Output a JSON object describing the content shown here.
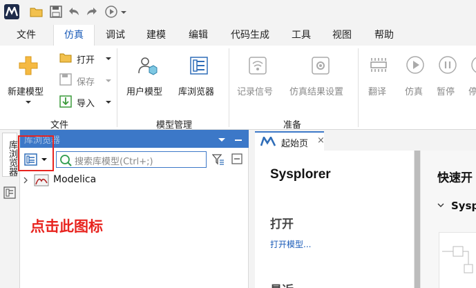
{
  "quick_access": {
    "icons": [
      "open-folder-icon",
      "save-icon",
      "undo-icon",
      "redo-icon",
      "run-icon",
      "dropdown-icon"
    ]
  },
  "menu": {
    "items": [
      {
        "label": "文件"
      },
      {
        "label": "仿真"
      },
      {
        "label": "调试"
      },
      {
        "label": "建模"
      },
      {
        "label": "编辑"
      },
      {
        "label": "代码生成"
      },
      {
        "label": "工具"
      },
      {
        "label": "视图"
      },
      {
        "label": "帮助"
      }
    ],
    "active_index": 1
  },
  "ribbon": {
    "file_group": {
      "new_model": "新建模型",
      "open": "打开",
      "save": "保存",
      "import": "导入",
      "label": "文件"
    },
    "model_group": {
      "user_model": "用户模型",
      "library_browser": "库浏览器",
      "label": "模型管理"
    },
    "prepare_group": {
      "record_signal": "记录信号",
      "sim_result_settings": "仿真结果设置",
      "label": "准备"
    },
    "sim_group": {
      "translate": "翻译",
      "simulate": "仿真",
      "pause": "暂停",
      "stop_partial": "停"
    }
  },
  "side_tabs": {
    "library_tab": "库浏览器"
  },
  "library_panel": {
    "title": "库浏览器",
    "search_placeholder": "搜索库模型(Ctrl+;)",
    "tree": [
      {
        "label": "Modelica"
      }
    ]
  },
  "annotation": {
    "text": "点击此图标"
  },
  "document": {
    "tab_label": "起始页",
    "tab_close": "×",
    "start_page": {
      "title": "Sysplorer",
      "open_heading": "打开",
      "open_link": "打开模型...",
      "recent_heading": "最近"
    },
    "quick_start": {
      "title": "快速开",
      "sub": "Sysp"
    }
  },
  "colors": {
    "accent": "#3c78c8",
    "annotation_red": "#e8231e",
    "active_tab_text": "#1a5bb8"
  }
}
